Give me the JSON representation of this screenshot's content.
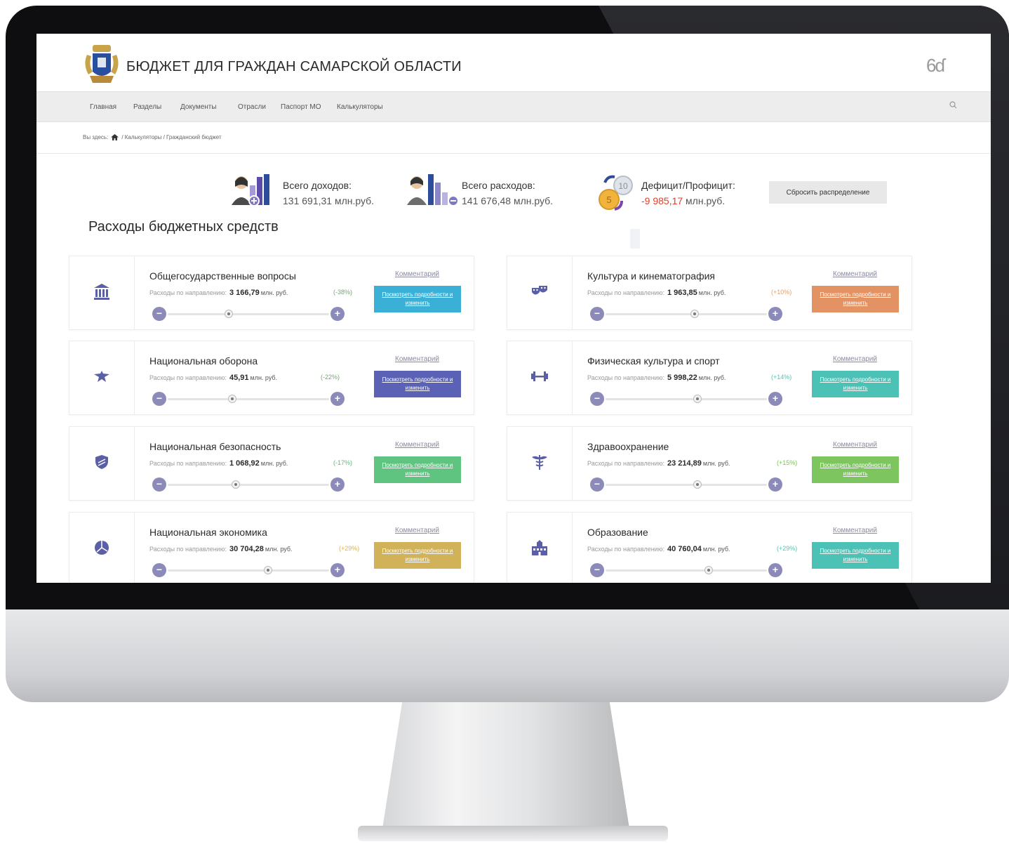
{
  "site": {
    "title": "БЮДЖЕТ ДЛЯ ГРАЖДАН САМАРСКОЙ ОБЛАСТИ",
    "glasses_glyph": "6ɗ"
  },
  "nav": {
    "items": [
      "Главная",
      "Разделы",
      "Документы",
      "Отрасли",
      "Паспорт МО",
      "Калькуляторы"
    ]
  },
  "breadcrumb": {
    "prefix": "Вы здесь:",
    "trail": "/ Калькуляторы / Гражданский бюджет"
  },
  "summary": {
    "income_label": "Всего доходов:",
    "income_value": "131 691,31 млн.руб.",
    "expense_label": "Всего расходов:",
    "expense_value": "141 676,48 млн.руб.",
    "deficit_label": "Дефицит/Профицит:",
    "deficit_value": "-9 985,17",
    "deficit_unit": " млн.руб.",
    "reset_label": "Сбросить распределение"
  },
  "section_title": "Расходы бюджетных средств",
  "cards": [
    {
      "title": "Общегосударственные вопросы",
      "row_label": "Расходы по направлению:",
      "amount": "3 166,79",
      "unit": "млн. руб.",
      "pct": "(-38%)",
      "comment": "Комментарий",
      "details": "Посмотреть подробности и изменить",
      "slider": 0.38
    },
    {
      "title": "Культура и кинематография",
      "row_label": "Расходы по направлению:",
      "amount": "1 963,85",
      "unit": "млн. руб.",
      "pct": "(+10%)",
      "comment": "Комментарий",
      "details": "Посмотреть подробности и изменить",
      "slider": 0.55
    },
    {
      "title": "Национальная оборона",
      "row_label": "Расходы по направлению:",
      "amount": "45,91",
      "unit": "млн. руб.",
      "pct": "(-22%)",
      "comment": "Комментарий",
      "details": "Посмотреть подробности и изменить",
      "slider": 0.4
    },
    {
      "title": "Физическая культура и спорт",
      "row_label": "Расходы по направлению:",
      "amount": "5 998,22",
      "unit": "млн. руб.",
      "pct": "(+14%)",
      "comment": "Комментарий",
      "details": "Посмотреть подробности и изменить",
      "slider": 0.57
    },
    {
      "title": "Национальная безопасность",
      "row_label": "Расходы по направлению:",
      "amount": "1 068,92",
      "unit": "млн. руб.",
      "pct": "(-17%)",
      "comment": "Комментарий",
      "details": "Посмотреть подробности и изменить",
      "slider": 0.42
    },
    {
      "title": "Здравоохранение",
      "row_label": "Расходы по направлению:",
      "amount": "23 214,89",
      "unit": "млн. руб.",
      "pct": "(+15%)",
      "comment": "Комментарий",
      "details": "Посмотреть подробности и изменить",
      "slider": 0.57
    },
    {
      "title": "Национальная экономика",
      "row_label": "Расходы по направлению:",
      "amount": "30 704,28",
      "unit": "млн. руб.",
      "pct": "(+29%)",
      "comment": "Комментарий",
      "details": "Посмотреть подробности и изменить",
      "slider": 0.62
    },
    {
      "title": "Образование",
      "row_label": "Расходы по направлению:",
      "amount": "40 760,04",
      "unit": "млн. руб.",
      "pct": "(+29%)",
      "comment": "Комментарий",
      "details": "Посмотреть подробности и изменить",
      "slider": 0.64
    }
  ],
  "colors": {
    "accent_slider": "#8b8ab8",
    "deficit": "#e0412f",
    "btn_blue": "#3bb0d6",
    "btn_orange": "#e39263",
    "btn_indigo": "#5b62b6",
    "btn_teal": "#4cc1b5",
    "btn_green": "#5ec47f",
    "btn_lime": "#7dc55e",
    "btn_gold": "#d1b258"
  },
  "icons": [
    "emblem-icon",
    "glasses-icon",
    "search-icon",
    "home-icon",
    "income-icon",
    "expense-icon",
    "coins-icon",
    "building-icon",
    "theater-masks-icon",
    "eagle-icon",
    "dumbbell-icon",
    "shield-icon",
    "caduceus-icon",
    "pie-chart-icon",
    "school-icon"
  ]
}
